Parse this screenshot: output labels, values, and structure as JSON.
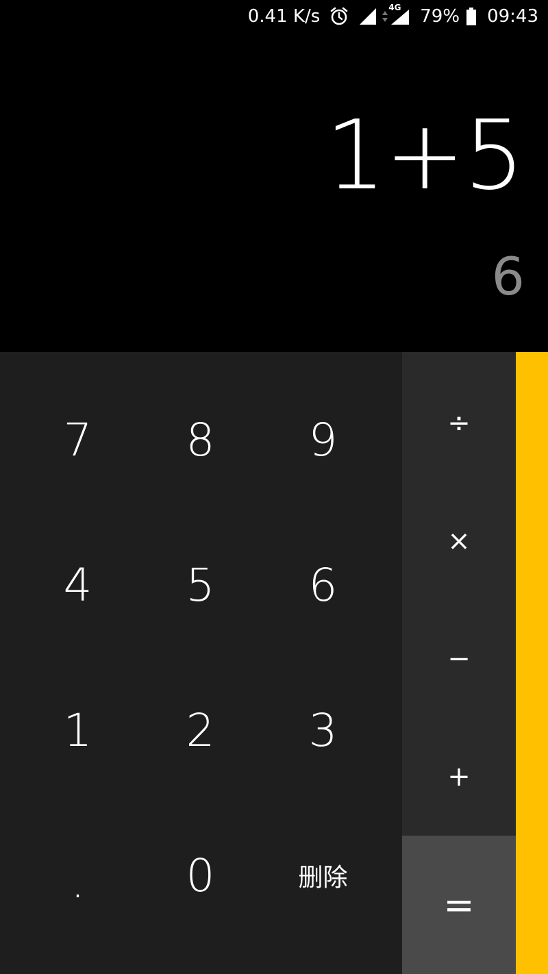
{
  "status_bar": {
    "net_speed": "0.41 K/s",
    "network_label": "4G",
    "battery_percent": "79%",
    "time": "09:43",
    "icons": [
      "alarm-icon",
      "signal-icon",
      "data-arrows-icon",
      "signal-4g-icon",
      "battery-icon"
    ]
  },
  "display": {
    "expression": "1+5",
    "result": "6"
  },
  "keypad": {
    "digits": {
      "k7": "7",
      "k8": "8",
      "k9": "9",
      "k4": "4",
      "k5": "5",
      "k6": "6",
      "k1": "1",
      "k2": "2",
      "k3": "3",
      "dot": ".",
      "k0": "0",
      "delete": "删除"
    },
    "operators": {
      "divide": "÷",
      "multiply": "×",
      "minus": "−",
      "plus": "+",
      "equals": "="
    }
  },
  "colors": {
    "background": "#000000",
    "keypad": "#1e1e1e",
    "operators": "#2a2a2a",
    "equals": "#4a4a4a",
    "accent": "#ffc000",
    "result_text": "#8a8a8a"
  }
}
